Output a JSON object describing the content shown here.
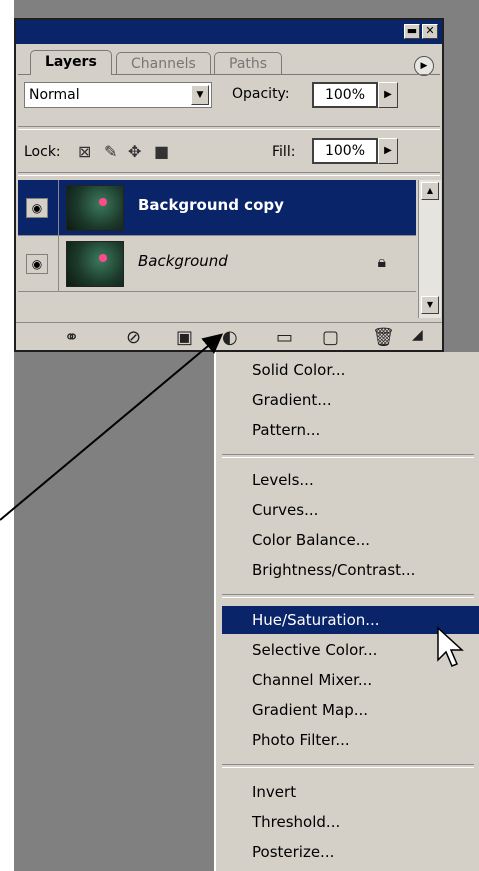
{
  "panel": {
    "tabs": [
      "Layers",
      "Channels",
      "Paths"
    ],
    "blend_mode": "Normal",
    "opacity_label": "Opacity:",
    "opacity_value": "100%",
    "lock_label": "Lock:",
    "fill_label": "Fill:",
    "fill_value": "100%",
    "layers": [
      {
        "name": "Background copy",
        "selected": true
      },
      {
        "name": "Background",
        "selected": false,
        "locked": true
      }
    ],
    "bottom_icons": [
      "link-icon",
      "layer-style-icon",
      "mask-icon",
      "adjustment-layer-icon",
      "folder-icon",
      "new-layer-icon",
      "trash-icon"
    ]
  },
  "menu": {
    "groups": [
      [
        "Solid Color...",
        "Gradient...",
        "Pattern..."
      ],
      [
        "Levels...",
        "Curves...",
        "Color Balance...",
        "Brightness/Contrast..."
      ],
      [
        "Hue/Saturation...",
        "Selective Color...",
        "Channel Mixer...",
        "Gradient Map...",
        "Photo Filter..."
      ],
      [
        "Invert",
        "Threshold...",
        "Posterize..."
      ]
    ],
    "highlighted": "Hue/Saturation..."
  },
  "colors": {
    "selection": "#0a246a",
    "panel_bg": "#d4d0c8",
    "backdrop": "#808080"
  }
}
